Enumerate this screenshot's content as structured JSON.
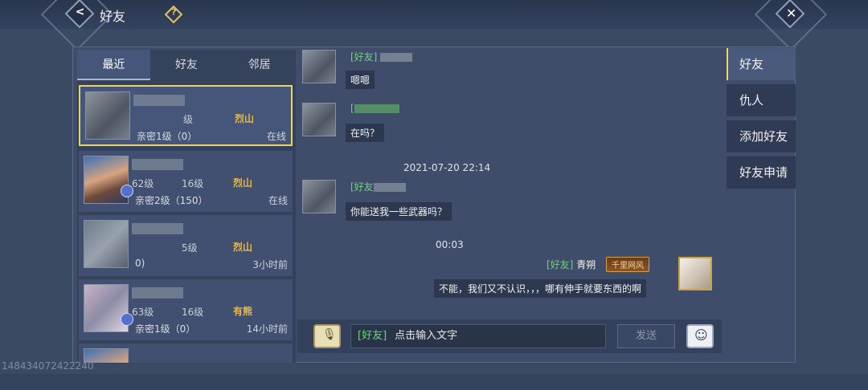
{
  "header": {
    "title": "好友",
    "help": "?",
    "back_icon": "chevron-left-icon",
    "close_icon": "close-icon"
  },
  "tabs": [
    "最近",
    "好友",
    "邻居"
  ],
  "friends": [
    {
      "level": "",
      "level2": "级",
      "sect": "烈山",
      "intimacy": "亲密1级（0）",
      "status": "在线"
    },
    {
      "level": "62级",
      "level2": "16级",
      "sect": "烈山",
      "intimacy": "亲密2级（150）",
      "status": "在线"
    },
    {
      "level": "",
      "level2": "5级",
      "sect": "烈山",
      "intimacy": "0)",
      "status": "3小时前"
    },
    {
      "level": "63级",
      "level2": "16级",
      "sect": "有熊",
      "intimacy": "亲密1级（0）",
      "status": "14小时前"
    }
  ],
  "chat": {
    "messages": [
      {
        "name_tag": "[好友]",
        "text": "嗯嗯"
      },
      {
        "name_tag": "[",
        "text": "在吗？"
      },
      {
        "timestamp": "2021-07-20 22:14"
      },
      {
        "name_tag": "[好友",
        "text": "你能送我一些武器吗？"
      },
      {
        "timestamp": "00:03"
      },
      {
        "name_tag": "[好友]",
        "name": "青朔",
        "vip": "千里网风",
        "text": "不能，我们又不认识，，，哪有伸手就要东西的啊"
      }
    ]
  },
  "input": {
    "tag": "[好友]",
    "placeholder": "点击输入文字",
    "send": "发送",
    "voice_icon": "microphone-icon",
    "emoji_icon": "emoji-icon"
  },
  "side_tabs": [
    "好友",
    "仇人",
    "添加好友",
    "好友申请"
  ],
  "watermark": "148434072422240"
}
